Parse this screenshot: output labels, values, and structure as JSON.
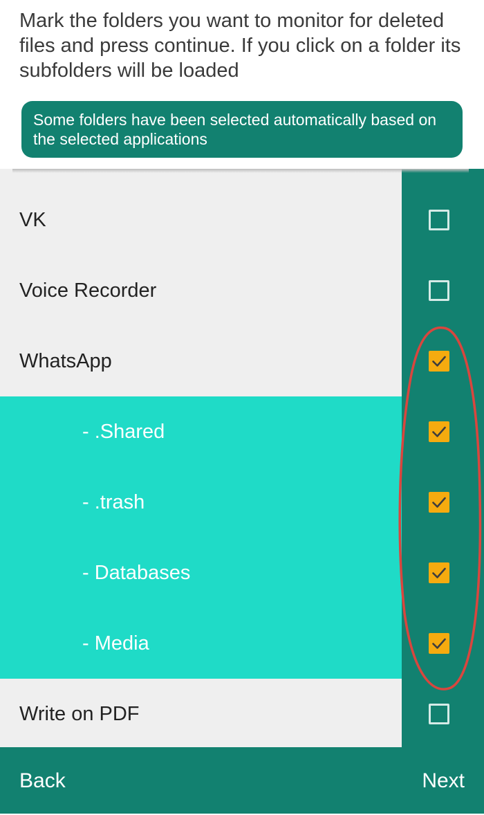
{
  "instructions": "Mark the folders you want to monitor for deleted files and press continue. If you click on a folder its subfolders will be loaded",
  "info_banner": "Some folders have been selected automatically based on the selected applications",
  "folders": [
    {
      "label": "VK",
      "checked": false,
      "subfolder": false
    },
    {
      "label": "Voice Recorder",
      "checked": false,
      "subfolder": false
    },
    {
      "label": "WhatsApp",
      "checked": true,
      "subfolder": false
    },
    {
      "label": "- .Shared",
      "checked": true,
      "subfolder": true
    },
    {
      "label": "- .trash",
      "checked": true,
      "subfolder": true
    },
    {
      "label": "- Databases",
      "checked": true,
      "subfolder": true
    },
    {
      "label": "- Media",
      "checked": true,
      "subfolder": true
    },
    {
      "label": "Write on PDF",
      "checked": false,
      "subfolder": false
    }
  ],
  "bottom_bar": {
    "back_label": "Back",
    "next_label": "Next"
  },
  "colors": {
    "primary_teal": "#128170",
    "subfolder_bg": "#1fdbc7",
    "checkbox_checked": "#f5ab0f",
    "annotation_red": "#d9463e"
  }
}
